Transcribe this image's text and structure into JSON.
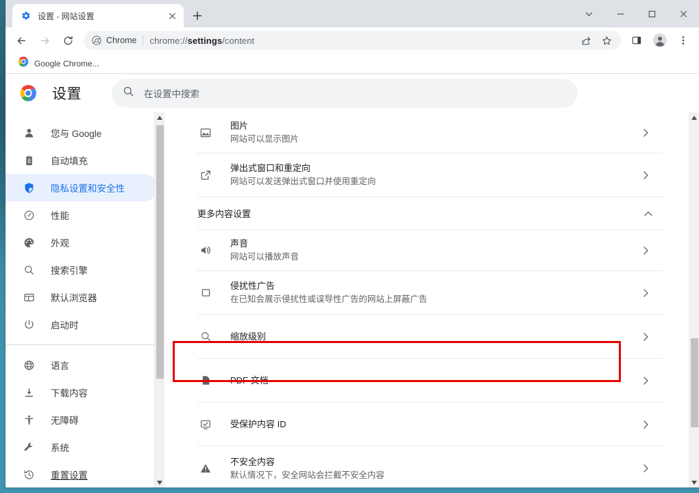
{
  "window": {
    "controls": {
      "minimize_label": "最小化",
      "maximize_label": "最大化",
      "close_label": "关闭",
      "tabsearch_label": "搜索标签页"
    }
  },
  "tabstrip": {
    "tabs": [
      {
        "title": "设置 - 网站设置",
        "favicon": "gear-icon",
        "active": true,
        "close_label": "×"
      }
    ],
    "new_tab_label": "+"
  },
  "toolbar": {
    "back_label": "←",
    "forward_label": "→",
    "reload_label": "⟳",
    "omnibox": {
      "chip_label": "Chrome",
      "url_prefix": "chrome://",
      "url_bold": "settings",
      "url_suffix": "/content",
      "share_icon": "share-icon",
      "bookmark_icon": "star-icon"
    },
    "sidepanel_icon": "side-panel-icon",
    "profile_icon": "profile-avatar-icon",
    "menu_icon": "three-dot-menu-icon"
  },
  "bookmarkbar": {
    "items": [
      {
        "label": "Google Chrome...",
        "icon": "chrome-logo-icon"
      }
    ]
  },
  "settings_header": {
    "logo": "chrome-logo-icon",
    "title": "设置",
    "search": {
      "icon": "search-icon",
      "placeholder": "在设置中搜索",
      "value": ""
    }
  },
  "sidebar": {
    "groups": [
      {
        "items": [
          {
            "label": "您与 Google",
            "icon": "person-icon",
            "selected": false
          },
          {
            "label": "自动填充",
            "icon": "clipboard-icon",
            "selected": false
          },
          {
            "label": "隐私设置和安全性",
            "icon": "shield-icon",
            "selected": true
          },
          {
            "label": "性能",
            "icon": "speedometer-icon",
            "selected": false
          },
          {
            "label": "外观",
            "icon": "palette-icon",
            "selected": false
          },
          {
            "label": "搜索引擎",
            "icon": "search-icon",
            "selected": false
          },
          {
            "label": "默认浏览器",
            "icon": "browser-window-icon",
            "selected": false
          },
          {
            "label": "启动时",
            "icon": "power-icon",
            "selected": false
          }
        ]
      },
      {
        "items": [
          {
            "label": "语言",
            "icon": "globe-icon",
            "selected": false
          },
          {
            "label": "下载内容",
            "icon": "download-icon",
            "selected": false
          },
          {
            "label": "无障碍",
            "icon": "accessibility-icon",
            "selected": false
          },
          {
            "label": "系统",
            "icon": "wrench-icon",
            "selected": false
          },
          {
            "label": "重置设置",
            "icon": "history-restore-icon",
            "selected": false,
            "underline": true
          }
        ]
      }
    ],
    "scrollbar": {
      "up_arrow": "▲",
      "down_arrow": "▼"
    }
  },
  "content": {
    "rows_top": [
      {
        "title": "图片",
        "subtitle": "网站可以显示图片",
        "icon": "image-icon",
        "chevron": "▸"
      },
      {
        "title": "弹出式窗口和重定向",
        "subtitle": "网站可以发送弹出式窗口并使用重定向",
        "icon": "external-link-icon",
        "chevron": "▸"
      }
    ],
    "section": {
      "label": "更多内容设置",
      "expanded": true,
      "chevron": "︿"
    },
    "rows_more": [
      {
        "title": "声音",
        "subtitle": "网站可以播放声音",
        "icon": "volume-icon",
        "chevron": "▸",
        "highlighted": true
      },
      {
        "title": "侵扰性广告",
        "subtitle": "在已知会展示侵扰性或误导性广告的网站上屏蔽广告",
        "icon": "ad-block-icon",
        "chevron": "▸",
        "highlighted": false
      },
      {
        "title": "缩放级别",
        "subtitle": "",
        "icon": "search-icon",
        "chevron": "▸",
        "highlighted": false
      },
      {
        "title": "PDF 文档",
        "subtitle": "",
        "icon": "pdf-icon",
        "chevron": "▸",
        "highlighted": false
      },
      {
        "title": "受保护内容 ID",
        "subtitle": "",
        "icon": "protected-content-icon",
        "chevron": "▸",
        "highlighted": false
      },
      {
        "title": "不安全内容",
        "subtitle": "默认情况下，安全网站会拦截不安全内容",
        "icon": "warning-icon",
        "chevron": "▸",
        "highlighted": false
      }
    ],
    "scrollbar": {
      "up_arrow": "▲",
      "down_arrow": "▼"
    }
  },
  "colors": {
    "accent": "#1a73e8",
    "highlight_border": "#e60000",
    "selected_bg": "#e8f0fe",
    "text_primary": "#202124",
    "text_secondary": "#5f6368",
    "divider": "#e8eaed",
    "toolbar_bg": "#ffffff",
    "frame_bg": "#dee1e6"
  }
}
